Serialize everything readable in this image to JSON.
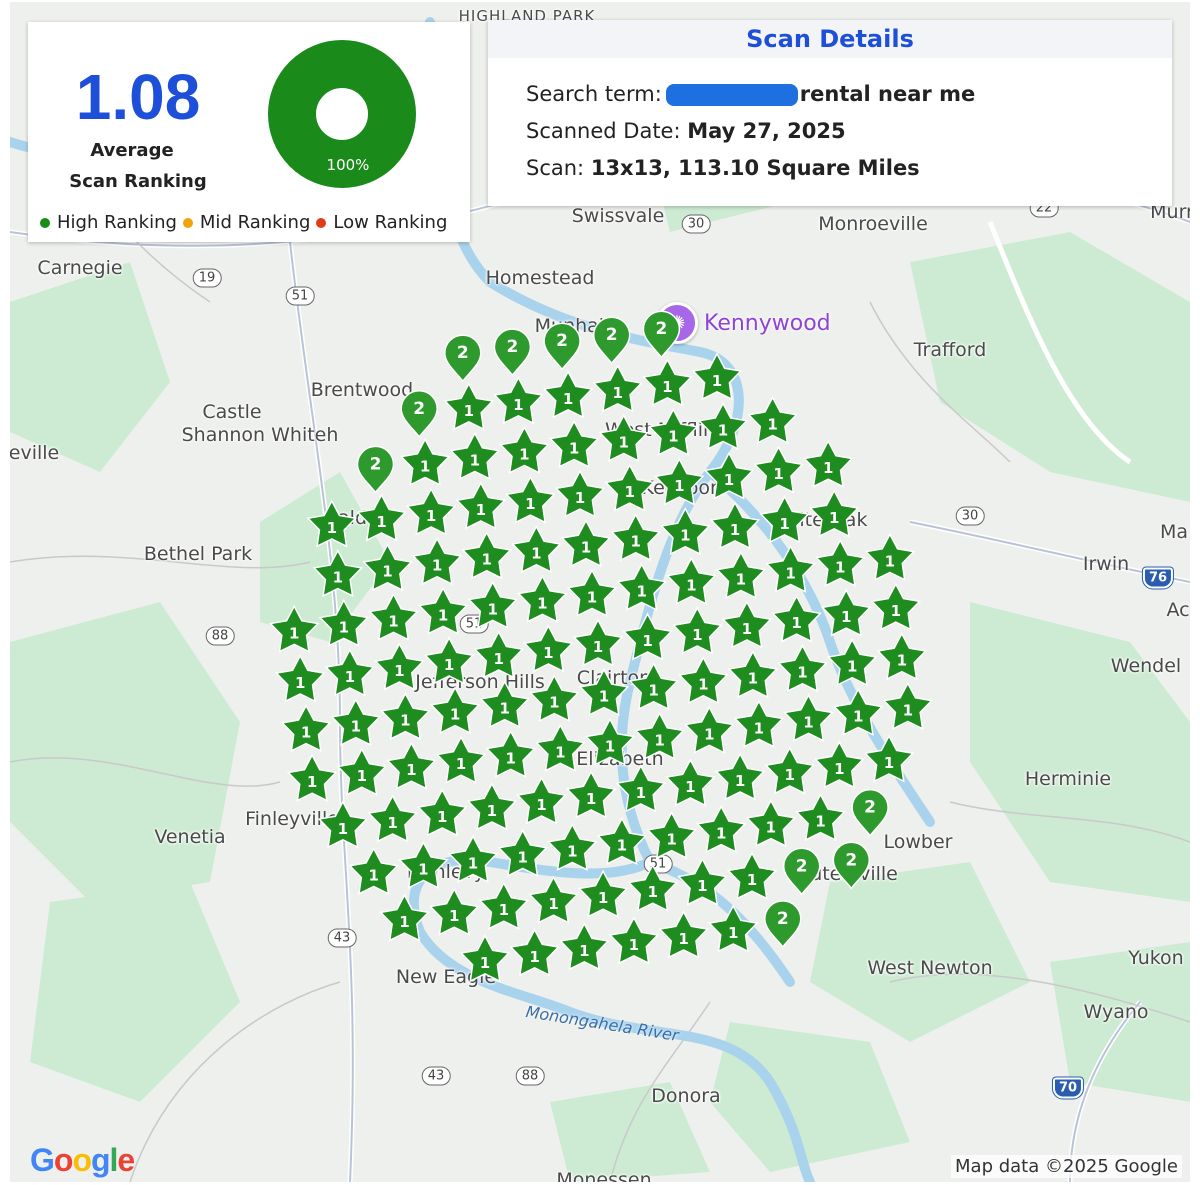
{
  "summary": {
    "average_value": "1.08",
    "average_label_1": "Average",
    "average_label_2": "Scan Ranking",
    "percent_label": "100%",
    "percent_value": 100,
    "legend": [
      {
        "label": "High Ranking",
        "color": "#1a8a1a"
      },
      {
        "label": "Mid Ranking",
        "color": "#f0a30a"
      },
      {
        "label": "Low Ranking",
        "color": "#e23b1a"
      }
    ]
  },
  "scan_details": {
    "title": "Scan Details",
    "search_term_label": "Search term:",
    "search_term_value": "rental near me",
    "scanned_date_label": "Scanned Date:",
    "scanned_date_value": "May 27, 2025",
    "scan_label": "Scan:",
    "scan_value": "13x13, 113.10 Square Miles"
  },
  "map": {
    "places": [
      "HIGHLAND PARK",
      "Swissvale",
      "Monroeville",
      "Murr",
      "Carnegie",
      "Homestead",
      "Munhall",
      "Trafford",
      "Brentwood",
      "Castle",
      "Shannon Whiteh",
      "eville",
      "West Mifflin",
      "McKeesport",
      "White Oak",
      "Bald",
      "Bethel Park",
      "Irwin",
      "Ma",
      "Ac",
      "Wendel",
      "Jefferson Hills",
      "Clairton",
      "Elizabeth",
      "Finleyville",
      "Venetia",
      "Herminie",
      "Lowber",
      "Sutersville",
      "Dunlevy",
      "New Eagle",
      "West Newton",
      "Yukon",
      "Wyano",
      "Donora",
      "Monessen"
    ],
    "roads": [
      "19",
      "51",
      "30",
      "22",
      "88",
      "43",
      "76",
      "70",
      "51",
      "51",
      "30",
      "88",
      "43"
    ],
    "poi": "Kennywood",
    "river": "Monongahela River",
    "logo": "Google",
    "attribution": "Map data ©2025 Google"
  },
  "grid": {
    "size": 13,
    "rows": [
      [
        2,
        2,
        2,
        2,
        2
      ],
      [
        2,
        1,
        1,
        1,
        1,
        1,
        1
      ],
      [
        2,
        1,
        1,
        1,
        1,
        1,
        1,
        1,
        1
      ],
      [
        1,
        1,
        1,
        1,
        1,
        1,
        1,
        1,
        1,
        1,
        1
      ],
      [
        1,
        1,
        1,
        1,
        1,
        1,
        1,
        1,
        1,
        1,
        1
      ],
      [
        1,
        1,
        1,
        1,
        1,
        1,
        1,
        1,
        1,
        1,
        1,
        1,
        1
      ],
      [
        1,
        1,
        1,
        1,
        1,
        1,
        1,
        1,
        1,
        1,
        1,
        1,
        1
      ],
      [
        1,
        1,
        1,
        1,
        1,
        1,
        1,
        1,
        1,
        1,
        1,
        1,
        1
      ],
      [
        1,
        1,
        1,
        1,
        1,
        1,
        1,
        1,
        1,
        1,
        1,
        1,
        1
      ],
      [
        1,
        1,
        1,
        1,
        1,
        1,
        1,
        1,
        1,
        1,
        1,
        1
      ],
      [
        1,
        1,
        1,
        1,
        1,
        1,
        1,
        1,
        1,
        1,
        2
      ],
      [
        1,
        1,
        1,
        1,
        1,
        1,
        1,
        1,
        2,
        2
      ],
      [
        1,
        1,
        1,
        1,
        1,
        1,
        2
      ]
    ]
  }
}
